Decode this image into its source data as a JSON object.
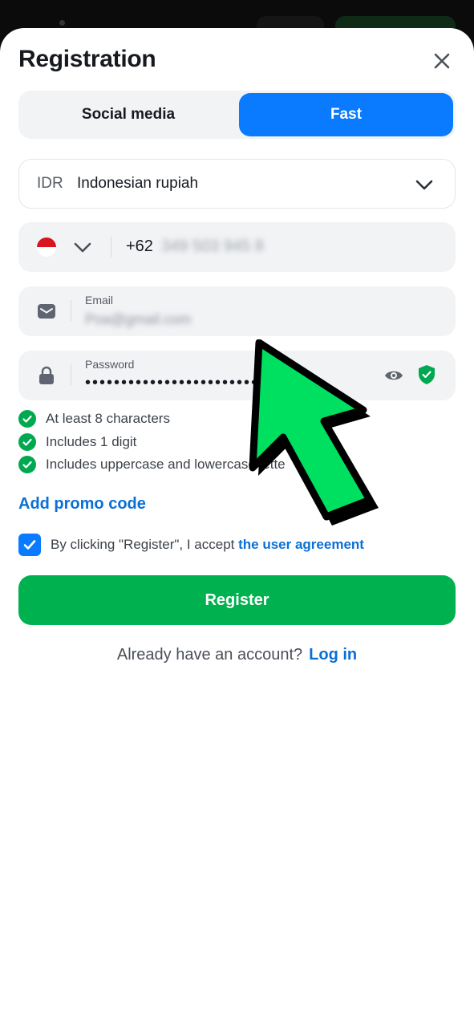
{
  "header": {
    "title": "Registration"
  },
  "tabs": [
    {
      "label": "Social media",
      "active": false
    },
    {
      "label": "Fast",
      "active": true
    }
  ],
  "currency": {
    "code": "IDR",
    "name": "Indonesian rupiah"
  },
  "phone": {
    "prefix": "+62",
    "number": "349 503 945 8"
  },
  "email": {
    "label": "Email",
    "value": "Poa@gmail.com"
  },
  "password": {
    "label": "Password",
    "value": "•••••••••••••••••••••••••"
  },
  "rules": [
    "At least 8 characters",
    "Includes 1 digit",
    "Includes uppercase and lowercase lette"
  ],
  "promo": {
    "label": "Add promo code"
  },
  "agreement": {
    "text": "By clicking \"Register\", I accept ",
    "link": "the user agreement",
    "checked": true
  },
  "register": {
    "label": "Register"
  },
  "login": {
    "question": "Already have an account?",
    "link": "Log in"
  },
  "colors": {
    "accent_blue": "#0a7aff",
    "link_blue": "#0a6fd6",
    "register_green": "#00b14f",
    "check_green": "#00a950",
    "arrow_green": "#00e060"
  }
}
